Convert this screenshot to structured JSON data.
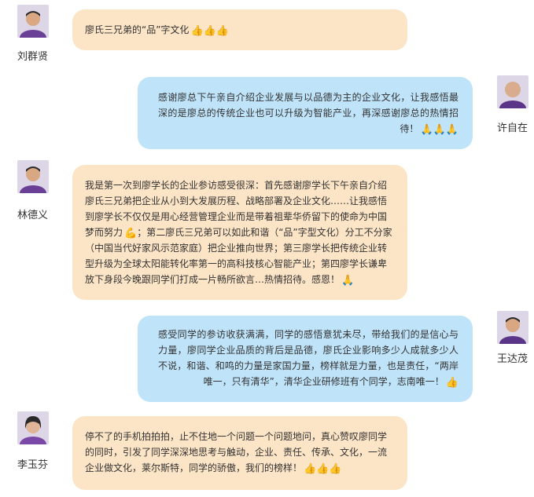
{
  "messages": [
    {
      "name": "刘群贤",
      "side": "left",
      "text": "廖氏三兄弟的“品”字文化",
      "emoji": "👍👍👍"
    },
    {
      "name": "许自在",
      "side": "right",
      "text": "感谢廖总下午亲自介绍企业发展与以品德为主的企业文化，让我感悟最深的是廖总的传统企业也可以升级为智能产业，再深感谢廖总的热情招待！",
      "emoji": "🙏🙏🙏"
    },
    {
      "name": "林德义",
      "side": "left",
      "text_a": "我是第一次到廖学长的企业参访感受很深：首先感谢廖学长下午亲自介绍廖氏三兄弟把企业从小到大发展历程、战略部署及企业文化……让我感悟到廖学长不仅仅是用心经营管理企业而是带着祖辈华侨留下的使命为中国梦而努力",
      "emoji_a": "💪",
      "text_b": "；第二廖氏三兄弟可以如此和谐（“品”字型文化）分工不分家（中国当代好家风示范家庭）把企业推向世界；第三廖学长把传统企业转型升级为全球太阳能转化率第一的高科技核心智能产业；第四廖学长谦卑放下身段今晚跟同学们打成一片畅所欲言…热情招待。感恩！",
      "emoji_b": "🙏"
    },
    {
      "name": "王达茂",
      "side": "right",
      "text": "感受同学的参访收获满满，同学的感悟意犹未尽，带给我们的是信心与力量，廖同学企业品质的背后是品德，廖氏企业影响多少人成就多少人不说，和谐、和鸣的力量是家国力量，榜样就是力量，也是责任，“两岸唯一，只有清华”，清华企业研修班有个同学，志南唯一！",
      "emoji": "👍"
    },
    {
      "name": "李玉芬",
      "side": "left",
      "text": "停不了的手机拍拍拍，止不住地一个问题一个问题地问，真心赞叹廖同学的同时，引发了同学深深地思考与触动，企业、责任、传承、文化，一流企业做文化，莱尔斯特，同学的骄傲，我们的榜样！",
      "emoji": "👍👍👍"
    }
  ],
  "colors": {
    "left_bubble": "#fce4c6",
    "right_bubble": "#bfe3f8",
    "avatar_bg": "#6a3f96"
  }
}
